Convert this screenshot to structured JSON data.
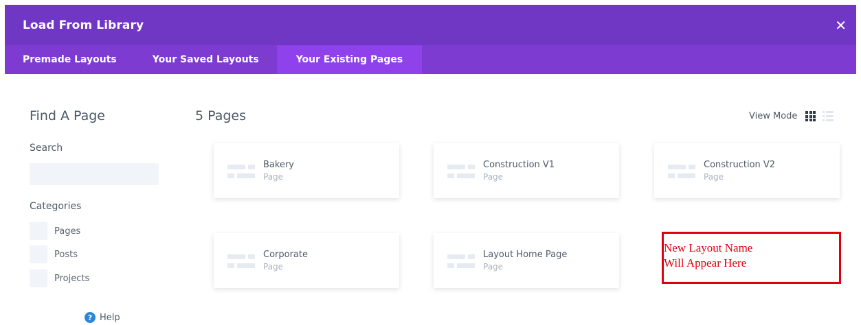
{
  "dialog": {
    "title": "Load From Library",
    "close_glyph": "✕"
  },
  "tabs": [
    {
      "label": "Premade Layouts",
      "active": false
    },
    {
      "label": "Your Saved Layouts",
      "active": false
    },
    {
      "label": "Your Existing Pages",
      "active": true
    }
  ],
  "sidebar": {
    "title": "Find A Page",
    "search_label": "Search",
    "search_value": "",
    "categories_label": "Categories",
    "categories": [
      {
        "label": "Pages"
      },
      {
        "label": "Posts"
      },
      {
        "label": "Projects"
      }
    ],
    "help_label": "Help",
    "help_glyph": "?"
  },
  "main": {
    "count_label": "5 Pages",
    "view_mode_label": "View Mode",
    "view_mode_selected": "grid",
    "cards": [
      {
        "name": "Bakery",
        "type": "Page"
      },
      {
        "name": "Construction V1",
        "type": "Page"
      },
      {
        "name": "Construction V2",
        "type": "Page"
      },
      {
        "name": "Corporate",
        "type": "Page"
      },
      {
        "name": "Layout Home Page",
        "type": "Page"
      }
    ],
    "placeholder_line1": "New Layout Name",
    "placeholder_line2": "Will Appear Here"
  },
  "colors": {
    "header_bg": "#7036c4",
    "tabbar_bg": "#7e3bd1",
    "active_tab_bg": "#8f42ec",
    "annotation_red": "#e0000d",
    "help_blue": "#2b87da"
  }
}
